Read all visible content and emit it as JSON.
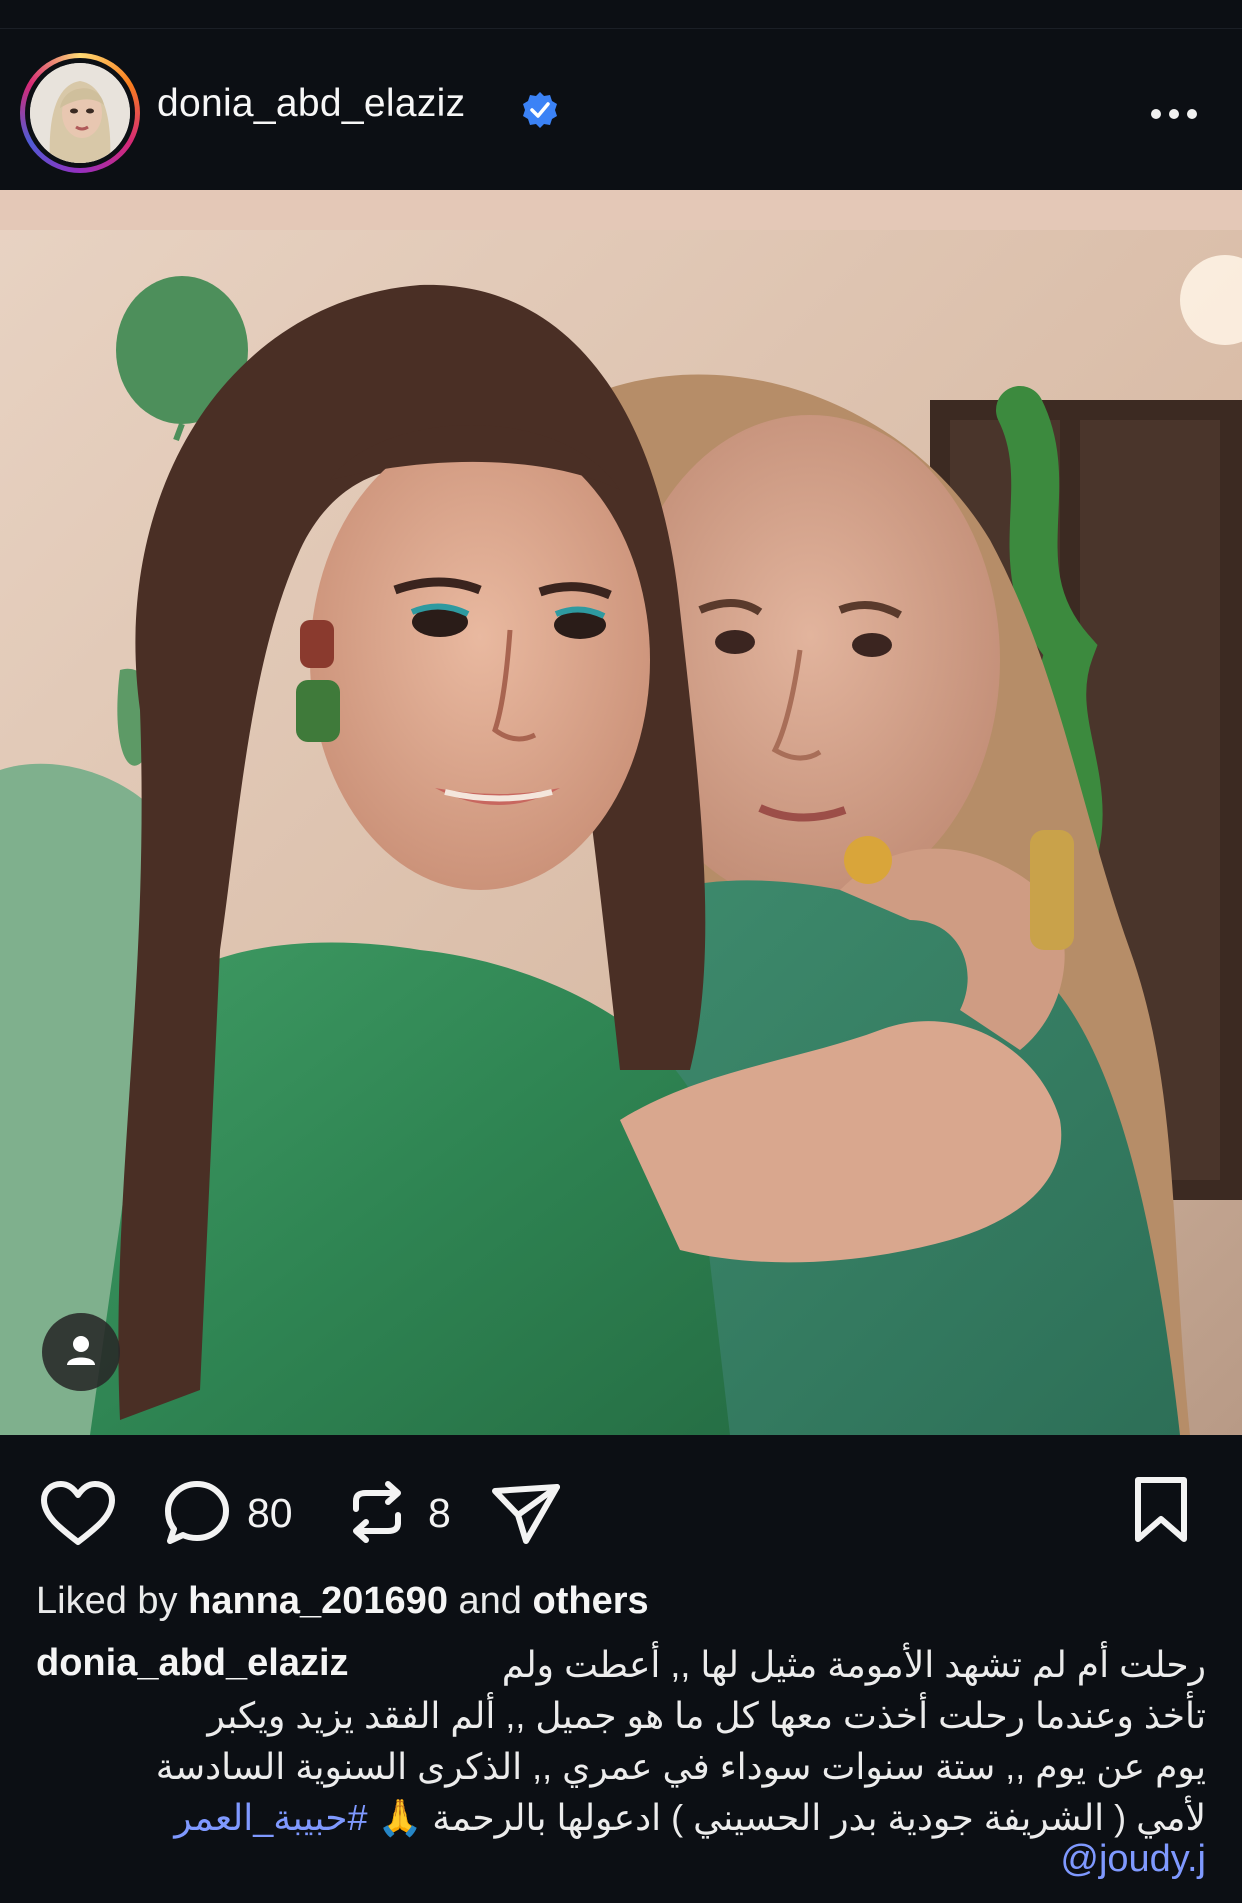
{
  "post": {
    "username": "donia_abd_elaziz",
    "verified": true,
    "header_icons": {
      "verified": "verified-badge-icon",
      "more": "more-options-icon"
    },
    "photo_icons": {
      "tag": "person-tag-icon"
    }
  },
  "actions": {
    "icons": [
      "heart-icon",
      "comment-icon",
      "repost-icon",
      "share-icon",
      "bookmark-icon"
    ],
    "comment_count": "80",
    "repost_count": "8"
  },
  "likes": {
    "prefix": "Liked by",
    "user": "hanna_201690",
    "middle": "and",
    "others": "others"
  },
  "caption": {
    "username": "donia_abd_elaziz",
    "line1": "رحلت أم لم تشهد الأمومة مثيل لها ,, أعطت ولم",
    "line2": "تأخذ  وعندما رحلت أخذت معها كل ما هو جميل ,, ألم الفقد يزيد ويكبر",
    "line3": "يوم عن يوم ,, ستة سنوات سوداء في عمري ,, الذكرى السنوية السادسة",
    "line4": "لأمي ( الشريفة جودية بدر الحسيني )  ادعولها بالرحمة 🙏",
    "hashtag": "#حبيبة_العمر",
    "mention": "@joudy.j"
  },
  "colors": {
    "background": "#0c0f14",
    "text": "#f5f5f5",
    "link": "#7f99ff",
    "verified": "#3b82f6"
  }
}
